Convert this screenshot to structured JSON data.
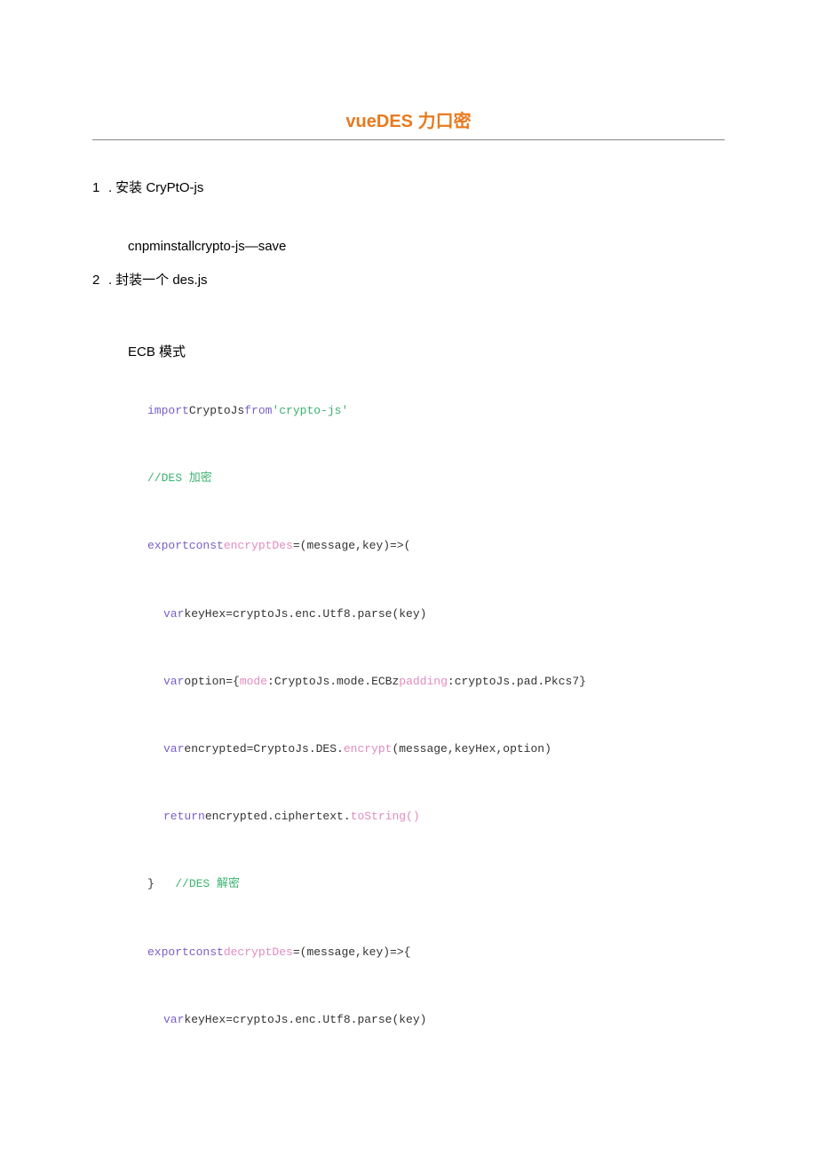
{
  "title": "vueDES 力口密",
  "item1_num": "1",
  "item1_dot": ".",
  "item1_text": "安装 CryPtO-js",
  "install_cmd": "cnpminstallcrypto-js—save",
  "item2_num": "2",
  "item2_dot": ".",
  "item2_text": "封装一个 des.js",
  "mode_label": "ECB 模式",
  "code": {
    "l1_import": "import",
    "l1_crypto": "CryptoJs",
    "l1_from": "from",
    "l1_pkg": "'crypto-js'",
    "l2_comment": "//DES 加密",
    "l3_export": "exportconst",
    "l3_name": "encryptDes",
    "l3_eq": "=(message,key)=>(",
    "l4_var": "var",
    "l4_body": "keyHex=cryptoJs.enc.Utf8.parse(key)",
    "l5_var": "var",
    "l5_a": "option={",
    "l5_mode": "mode",
    "l5_b": ":CryptoJs.mode.ECB",
    "l5_comma": "z",
    "l5_padding": "padding",
    "l5_c": ":cryptoJs.pad.Pkcs7}",
    "l6_var": "var",
    "l6_a": "encrypted=CryptoJs.DES.",
    "l6_enc": "encrypt",
    "l6_b": "(message,keyHex,option)",
    "l7_return": "return",
    "l7_a": "encrypted.ciphertext.",
    "l7_ts": "toString()",
    "l8_brace": "}",
    "l8_comment": "//DES 解密",
    "l9_export": "exportconst",
    "l9_name": "decryptDes",
    "l9_eq": "=(message,key)=>{",
    "l10_var": "var",
    "l10_body": "keyHex=cryptoJs.enc.Utf8.parse(key)"
  }
}
